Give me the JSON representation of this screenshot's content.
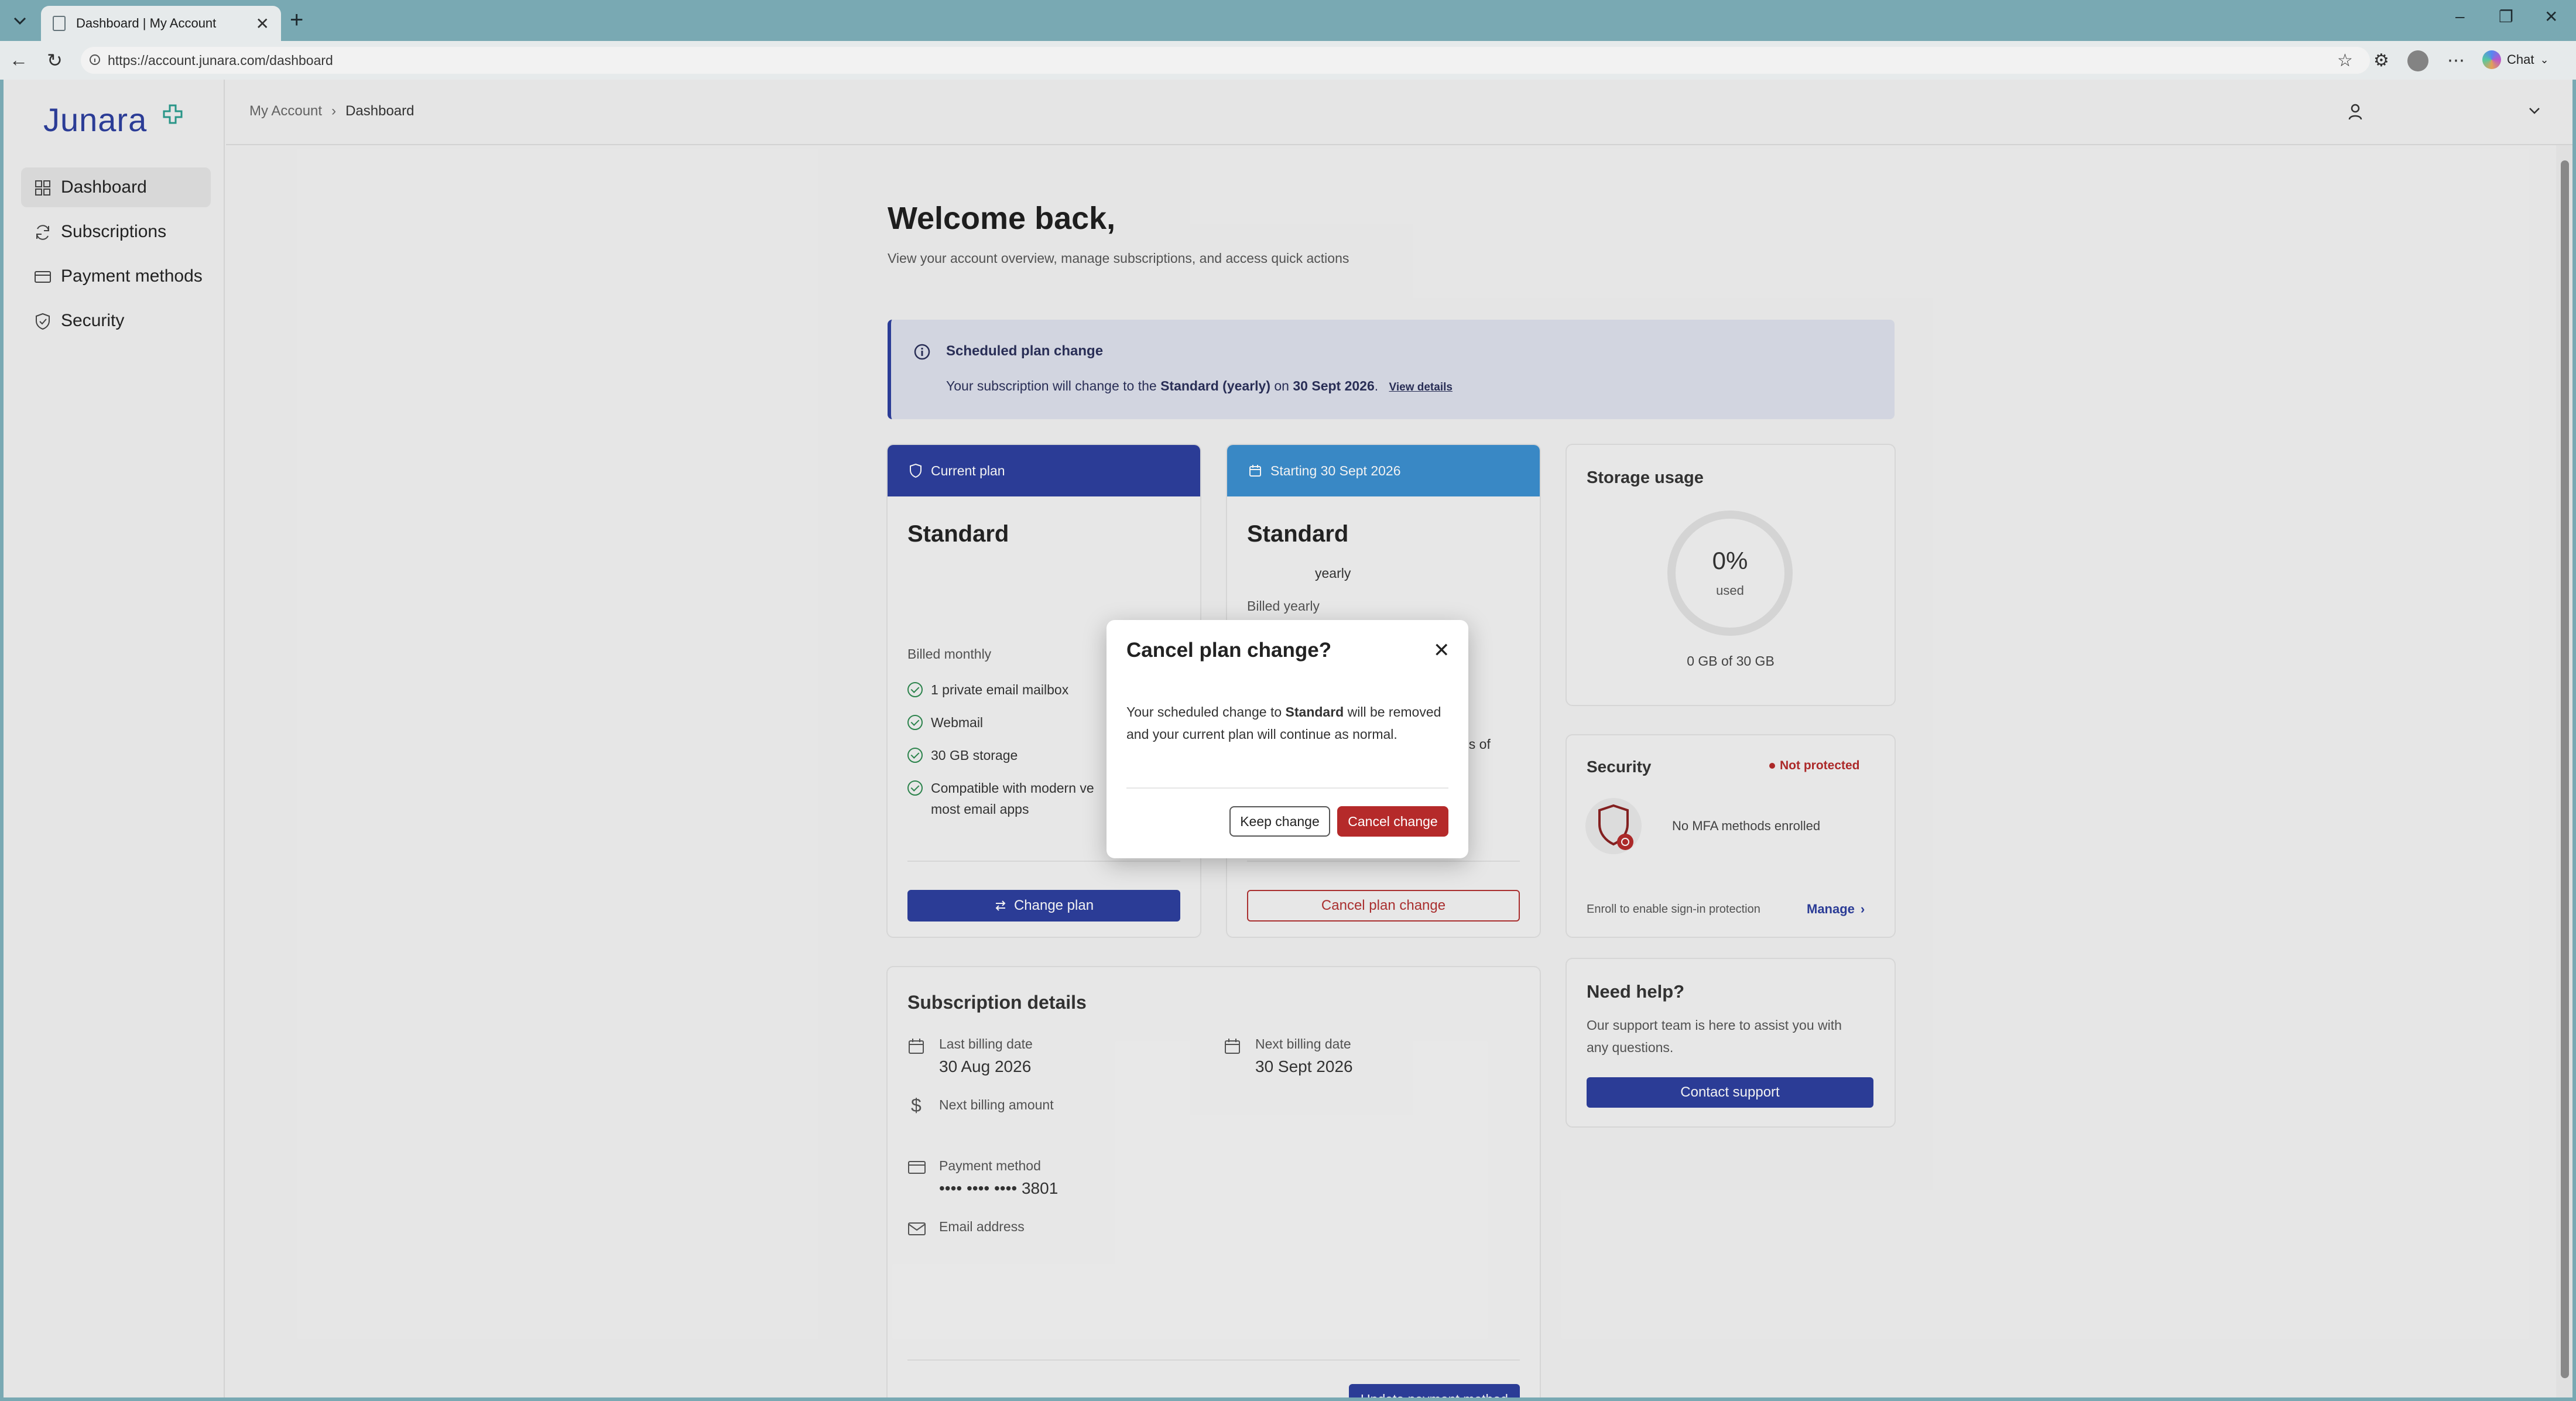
{
  "browser": {
    "tab_title": "Dashboard | My Account",
    "url": "https://account.junara.com/dashboard",
    "chat_label": "Chat"
  },
  "sidebar": {
    "brand": "Junara",
    "items": [
      {
        "label": "Dashboard",
        "icon": "grid-icon",
        "active": true
      },
      {
        "label": "Subscriptions",
        "icon": "refresh-icon"
      },
      {
        "label": "Payment methods",
        "icon": "card-icon"
      },
      {
        "label": "Security",
        "icon": "shield-icon"
      }
    ]
  },
  "breadcrumb": {
    "parent": "My Account",
    "current": "Dashboard"
  },
  "main": {
    "title": "Welcome back,",
    "subtitle": "View your account overview, manage subscriptions, and access quick actions"
  },
  "banner": {
    "title": "Scheduled plan change",
    "text_prefix": "Your subscription will change to the",
    "plan": "Standard (yearly)",
    "text_mid": "on",
    "date": "30 Sept 2026",
    "text_end": ".",
    "link": "View details"
  },
  "current_plan": {
    "header": "Current plan",
    "name": "Standard",
    "billing": "Billed monthly",
    "features": [
      "1 private email mailbox",
      "Webmail",
      "30 GB storage",
      "Compatible with modern ve",
      "most email apps"
    ],
    "button": "Change plan"
  },
  "next_plan": {
    "header": "Starting 30 Sept 2026",
    "name": "Standard",
    "period": "yearly",
    "billing": "Billed yearly",
    "partial_text": "ns of",
    "button": "Cancel plan change"
  },
  "storage": {
    "title": "Storage usage",
    "percent": "0%",
    "used_label": "used",
    "summary": "0 GB of 30 GB",
    "fraction_used": 0
  },
  "security": {
    "title": "Security",
    "status": "Not protected",
    "mfa_text": "No MFA methods enrolled",
    "hint": "Enroll to enable sign-in protection",
    "manage": "Manage"
  },
  "help": {
    "title": "Need help?",
    "text_line1": "Our support team is here to assist you with",
    "text_line2": "any questions.",
    "button": "Contact support"
  },
  "subscription_details": {
    "title": "Subscription details",
    "last_billing_label": "Last billing date",
    "last_billing_value": "30 Aug 2026",
    "next_billing_label": "Next billing date",
    "next_billing_value": "30 Sept 2026",
    "amount_label": "Next billing amount",
    "payment_label": "Payment method",
    "payment_value": "•••• •••• •••• 3801",
    "email_label": "Email address",
    "button": "Update payment method"
  },
  "modal": {
    "title": "Cancel plan change?",
    "body_prefix": "Your scheduled change to",
    "body_plan": "Standard",
    "body_suffix": "will be removed and your current plan will continue as normal.",
    "keep": "Keep change",
    "cancel": "Cancel change"
  },
  "colors": {
    "brand": "#2c3e9e",
    "next_plan_header": "#3b8fd0",
    "danger": "#b52a2a",
    "success": "#2d8a4f"
  }
}
